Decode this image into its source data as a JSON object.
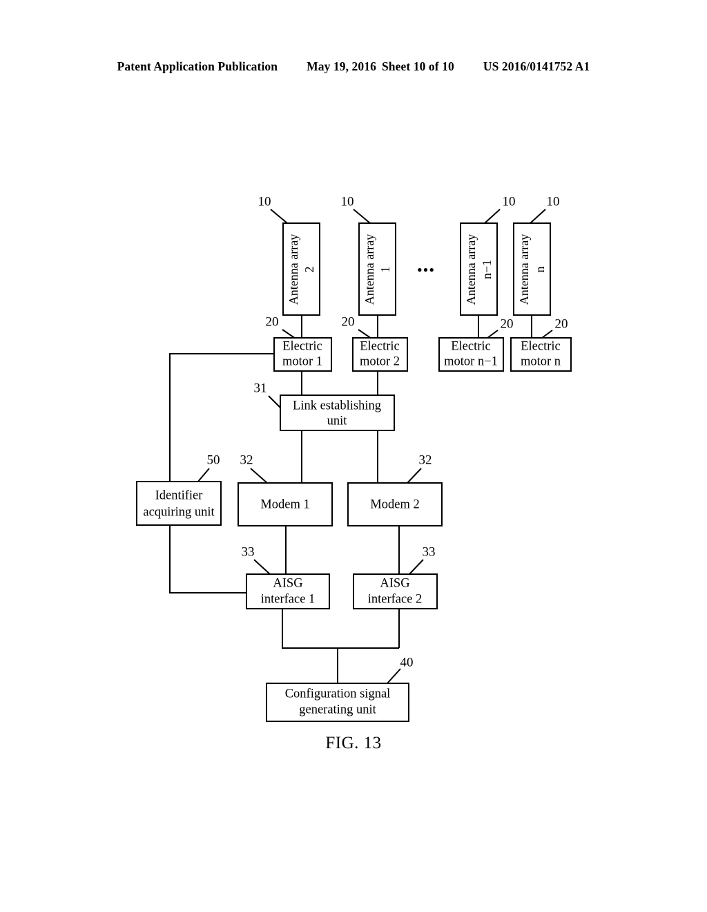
{
  "header": {
    "publication": "Patent Application Publication",
    "date": "May 19, 2016",
    "sheet": "Sheet 10 of 10",
    "patent_number": "US 2016/0141752 A1"
  },
  "figure": {
    "caption": "FIG. 13",
    "ellipsis": "•••",
    "blocks": {
      "antenna_array_2": {
        "line1": "Antenna array",
        "line2": "2",
        "ref": "10"
      },
      "antenna_array_1": {
        "line1": "Antenna array",
        "line2": "1",
        "ref": "10"
      },
      "antenna_array_n_minus_1": {
        "line1": "Antenna array",
        "line2": "n−1",
        "ref": "10"
      },
      "antenna_array_n": {
        "line1": "Antenna array",
        "line2": "n",
        "ref": "10"
      },
      "electric_motor_1": {
        "line1": "Electric",
        "line2": "motor 1",
        "ref": "20"
      },
      "electric_motor_2": {
        "line1": "Electric",
        "line2": "motor 2",
        "ref": "20"
      },
      "electric_motor_n_minus_1": {
        "line1": "Electric",
        "line2": "motor n−1",
        "ref": "20"
      },
      "electric_motor_n": {
        "line1": "Electric",
        "line2": "motor n",
        "ref": "20"
      },
      "link_establishing_unit": {
        "line1": "Link establishing",
        "line2": "unit",
        "ref": "31"
      },
      "identifier_acquiring_unit": {
        "line1": "Identifier",
        "line2": "acquiring unit",
        "ref": "50"
      },
      "modem_1": {
        "line1": "Modem 1",
        "line2": "",
        "ref": "32"
      },
      "modem_2": {
        "line1": "Modem 2",
        "line2": "",
        "ref": "32"
      },
      "aisg_interface_1": {
        "line1": "AISG",
        "line2": "interface 1",
        "ref": "33"
      },
      "aisg_interface_2": {
        "line1": "AISG",
        "line2": "interface 2",
        "ref": "33"
      },
      "configuration_signal_generating_unit": {
        "line1": "Configuration signal",
        "line2": "generating unit",
        "ref": "40"
      }
    }
  },
  "colors": {
    "ink": "#000000",
    "paper": "#ffffff"
  }
}
